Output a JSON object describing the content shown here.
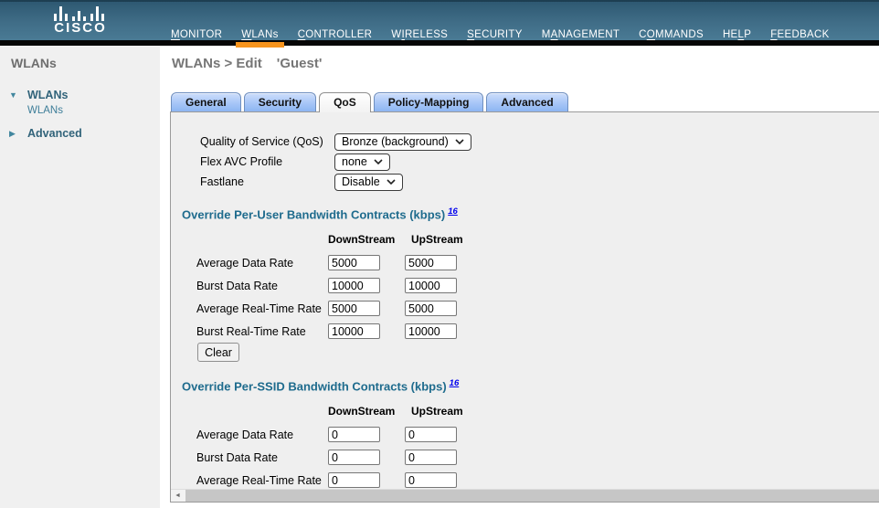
{
  "header": {
    "brand": "CISCO",
    "active_nav": "WLANs",
    "nav": [
      {
        "label": "MONITOR",
        "u": 0
      },
      {
        "label": "WLANs",
        "u": 0
      },
      {
        "label": "CONTROLLER",
        "u": 0
      },
      {
        "label": "WIRELESS",
        "u": 1
      },
      {
        "label": "SECURITY",
        "u": 0
      },
      {
        "label": "MANAGEMENT",
        "u": 1
      },
      {
        "label": "COMMANDS",
        "u": 1
      },
      {
        "label": "HELP",
        "u": 2
      },
      {
        "label": "FEEDBACK",
        "u": 0
      }
    ]
  },
  "icons": {
    "expanded": "▼",
    "collapsed": "▶",
    "scroll_left": "◄"
  },
  "sidebar": {
    "title": "WLANs",
    "tree": [
      {
        "label": "WLANs",
        "type": "expanded"
      },
      {
        "label": "WLANs",
        "type": "child"
      },
      {
        "label": "Advanced",
        "type": "collapsed"
      }
    ]
  },
  "main": {
    "breadcrumb": "WLANs > Edit",
    "wlan_name": "'Guest'",
    "tabs": [
      {
        "label": "General",
        "active": false
      },
      {
        "label": "Security",
        "active": false
      },
      {
        "label": "QoS",
        "active": true
      },
      {
        "label": "Policy-Mapping",
        "active": false
      },
      {
        "label": "Advanced",
        "active": false
      }
    ],
    "qos": {
      "fields": [
        {
          "label": "Quality of Service (QoS)",
          "value": "Bronze (background)"
        },
        {
          "label": "Flex AVC Profile",
          "value": "none"
        },
        {
          "label": "Fastlane",
          "value": "Disable"
        }
      ],
      "per_user": {
        "title": "Override Per-User Bandwidth Contracts (kbps)",
        "footnote": "16",
        "columns": [
          "DownStream",
          "UpStream"
        ],
        "rows": [
          {
            "label": "Average Data Rate",
            "down": "5000",
            "up": "5000"
          },
          {
            "label": "Burst Data Rate",
            "down": "10000",
            "up": "10000"
          },
          {
            "label": "Average Real-Time Rate",
            "down": "5000",
            "up": "5000"
          },
          {
            "label": "Burst Real-Time Rate",
            "down": "10000",
            "up": "10000"
          }
        ],
        "clear_label": "Clear"
      },
      "per_ssid": {
        "title": "Override Per-SSID Bandwidth Contracts (kbps)",
        "footnote": "16",
        "columns": [
          "DownStream",
          "UpStream"
        ],
        "rows": [
          {
            "label": "Average Data Rate",
            "down": "0",
            "up": "0"
          },
          {
            "label": "Burst Data Rate",
            "down": "0",
            "up": "0"
          },
          {
            "label": "Average Real-Time Rate",
            "down": "0",
            "up": "0"
          }
        ]
      }
    }
  },
  "colors": {
    "accent_orange": "#f7941d",
    "header_teal": "#3f6c86",
    "section_heading": "#1e6b8d",
    "tab_blue": "#a7c6f7",
    "panel_gray": "#efefef"
  }
}
